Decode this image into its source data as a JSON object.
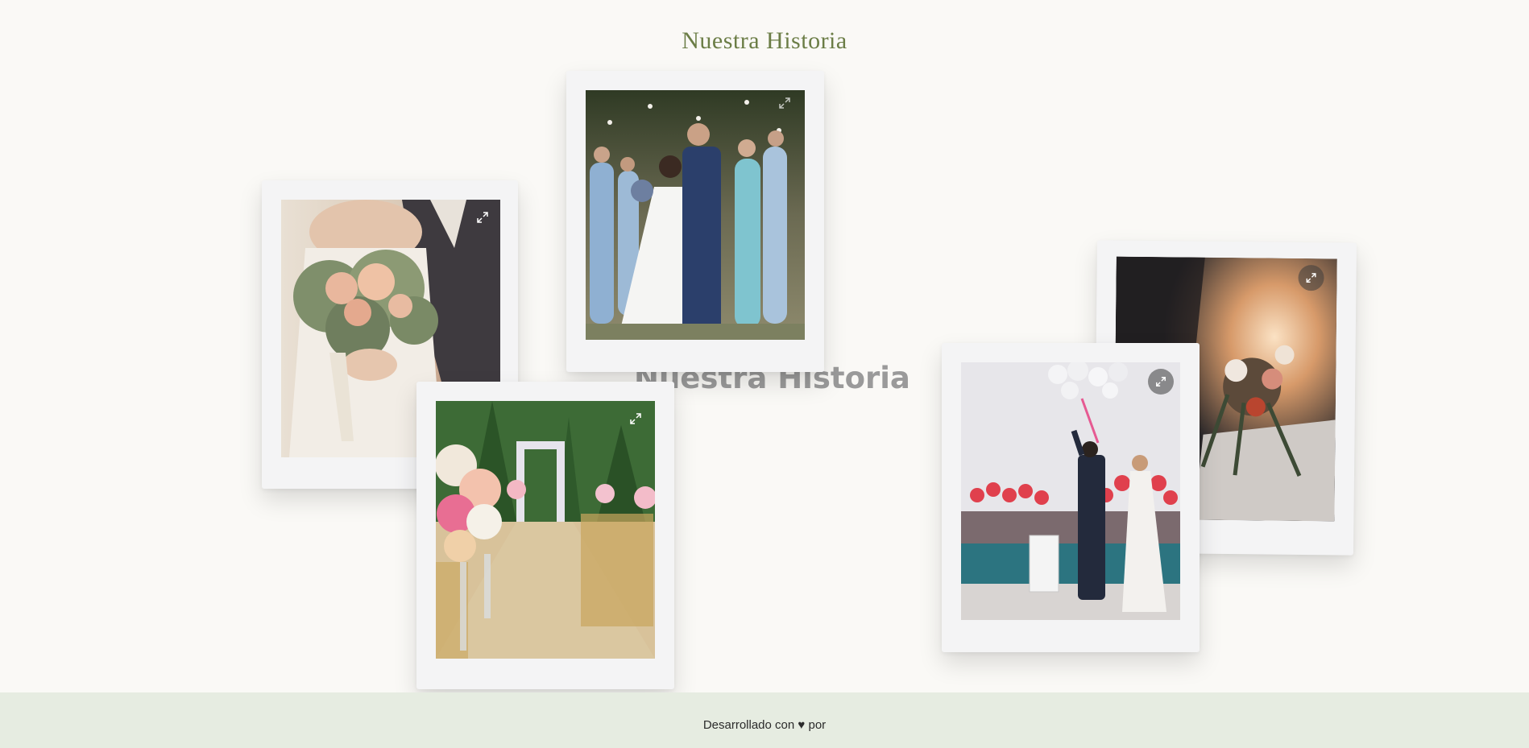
{
  "header": {
    "title": "Nuestra Historia"
  },
  "section": {
    "background_heading": "Nuestra Historia"
  },
  "gallery": {
    "photos": [
      {
        "name": "bride-bouquet-photo",
        "alt": ""
      },
      {
        "name": "couple-kiss-photo",
        "alt": ""
      },
      {
        "name": "flower-aisle-photo",
        "alt": ""
      },
      {
        "name": "couple-balloons-photo",
        "alt": ""
      },
      {
        "name": "bouquet-sunlight-photo",
        "alt": ""
      }
    ],
    "expand_icon": "expand-icon"
  },
  "footer": {
    "text_before": "Desarrollado con",
    "heart": "♥",
    "text_after": "por"
  },
  "colors": {
    "accent": "#6b7d46",
    "background": "#faf9f6",
    "footer_bg": "#e6ece1",
    "card_bg": "#f4f4f5"
  }
}
